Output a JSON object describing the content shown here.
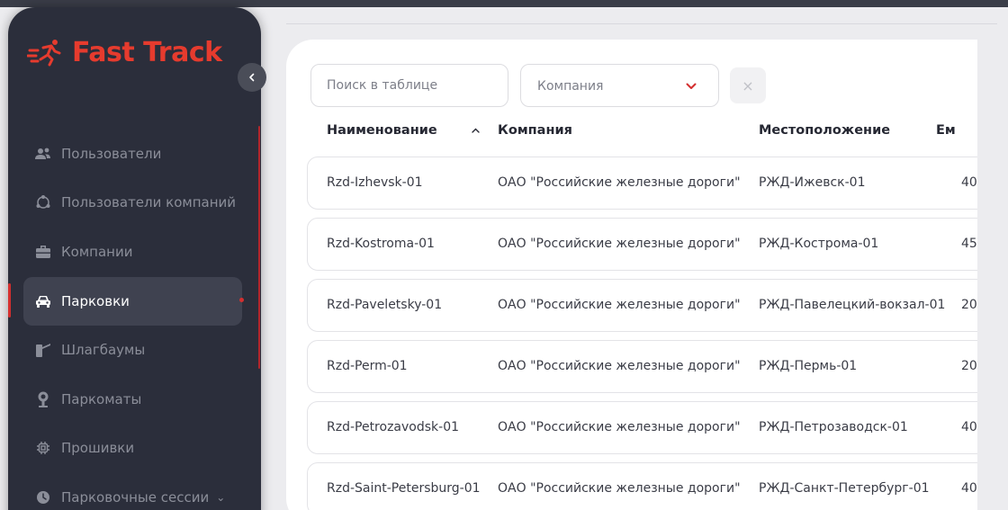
{
  "brand": {
    "name": "Fast Track",
    "color": "#e63b2e"
  },
  "sidebar": {
    "collapse_icon": "chevron-left-icon",
    "items": [
      {
        "label": "Пользователи",
        "icon": "users-icon"
      },
      {
        "label": "Пользователи компаний",
        "icon": "company-users-icon"
      },
      {
        "label": "Компании",
        "icon": "briefcase-icon"
      },
      {
        "label": "Парковки",
        "icon": "car-icon",
        "active": true
      },
      {
        "label": "Шлагбаумы",
        "icon": "barrier-icon"
      },
      {
        "label": "Паркоматы",
        "icon": "parking-meter-icon"
      },
      {
        "label": "Прошивки",
        "icon": "chip-icon"
      },
      {
        "label": "Парковочные сессии",
        "icon": "clock-icon"
      }
    ]
  },
  "filters": {
    "search_placeholder": "Поиск в таблице",
    "company_placeholder": "Компания",
    "clear_label": "×"
  },
  "table": {
    "columns": [
      "Наименование",
      "Компания",
      "Местоположение",
      "Ем"
    ],
    "rows": [
      [
        "Rzd-Izhevsk-01",
        "ОАО \"Российские железные дороги\"",
        "РЖД-Ижевск-01",
        "40"
      ],
      [
        "Rzd-Kostroma-01",
        "ОАО \"Российские железные дороги\"",
        "РЖД-Кострома-01",
        "45"
      ],
      [
        "Rzd-Paveletsky-01",
        "ОАО \"Российские железные дороги\"",
        "РЖД-Павелецкий-вокзал-01",
        "20"
      ],
      [
        "Rzd-Perm-01",
        "ОАО \"Российские железные дороги\"",
        "РЖД-Пермь-01",
        "20"
      ],
      [
        "Rzd-Petrozavodsk-01",
        "ОАО \"Российские железные дороги\"",
        "РЖД-Петрозаводск-01",
        "40"
      ],
      [
        "Rzd-Saint-Petersburg-01",
        "ОАО \"Российские железные дороги\"",
        "РЖД-Санкт-Петербург-01",
        "40"
      ]
    ]
  }
}
